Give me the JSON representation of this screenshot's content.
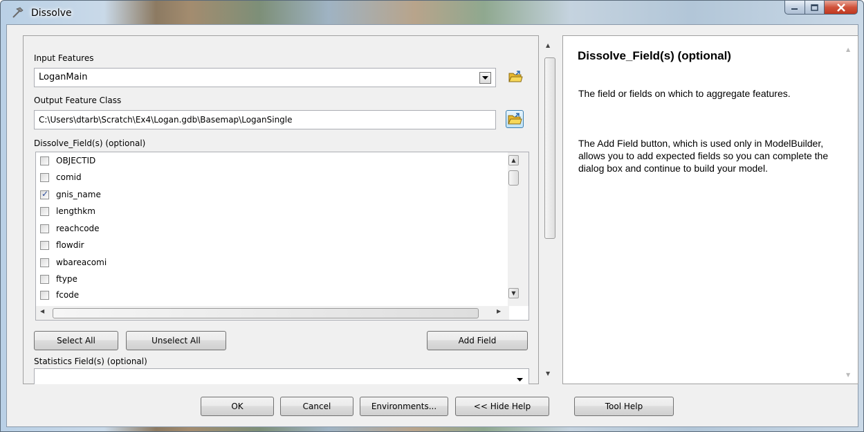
{
  "window": {
    "title": "Dissolve"
  },
  "colors": {
    "accent": "#3c7fb1",
    "close_red": "#c0381f"
  },
  "form": {
    "input_features_label": "Input Features",
    "input_features_value": "LoganMain",
    "output_feature_class_label": "Output Feature Class",
    "output_feature_class_value": "C:\\Users\\dtarb\\Scratch\\Ex4\\Logan.gdb\\Basemap\\LoganSingle",
    "dissolve_fields_label": "Dissolve_Field(s) (optional)",
    "fields": [
      {
        "name": "OBJECTID",
        "checked": false
      },
      {
        "name": "comid",
        "checked": false
      },
      {
        "name": "gnis_name",
        "checked": true
      },
      {
        "name": "lengthkm",
        "checked": false
      },
      {
        "name": "reachcode",
        "checked": false
      },
      {
        "name": "flowdir",
        "checked": false
      },
      {
        "name": "wbareacomi",
        "checked": false
      },
      {
        "name": "ftype",
        "checked": false
      },
      {
        "name": "fcode",
        "checked": false
      }
    ],
    "select_all_label": "Select All",
    "unselect_all_label": "Unselect All",
    "add_field_label": "Add Field",
    "statistics_fields_label": "Statistics Field(s) (optional)",
    "statistics_fields_value": ""
  },
  "footer": {
    "ok_label": "OK",
    "cancel_label": "Cancel",
    "environments_label": "Environments...",
    "hide_help_label": "<< Hide Help",
    "tool_help_label": "Tool Help"
  },
  "help": {
    "title": "Dissolve_Field(s) (optional)",
    "para1": "The field or fields on which to aggregate features.",
    "para2": "The Add Field button, which is used only in ModelBuilder, allows you to add expected fields so you can complete the dialog box and continue to build your model."
  }
}
